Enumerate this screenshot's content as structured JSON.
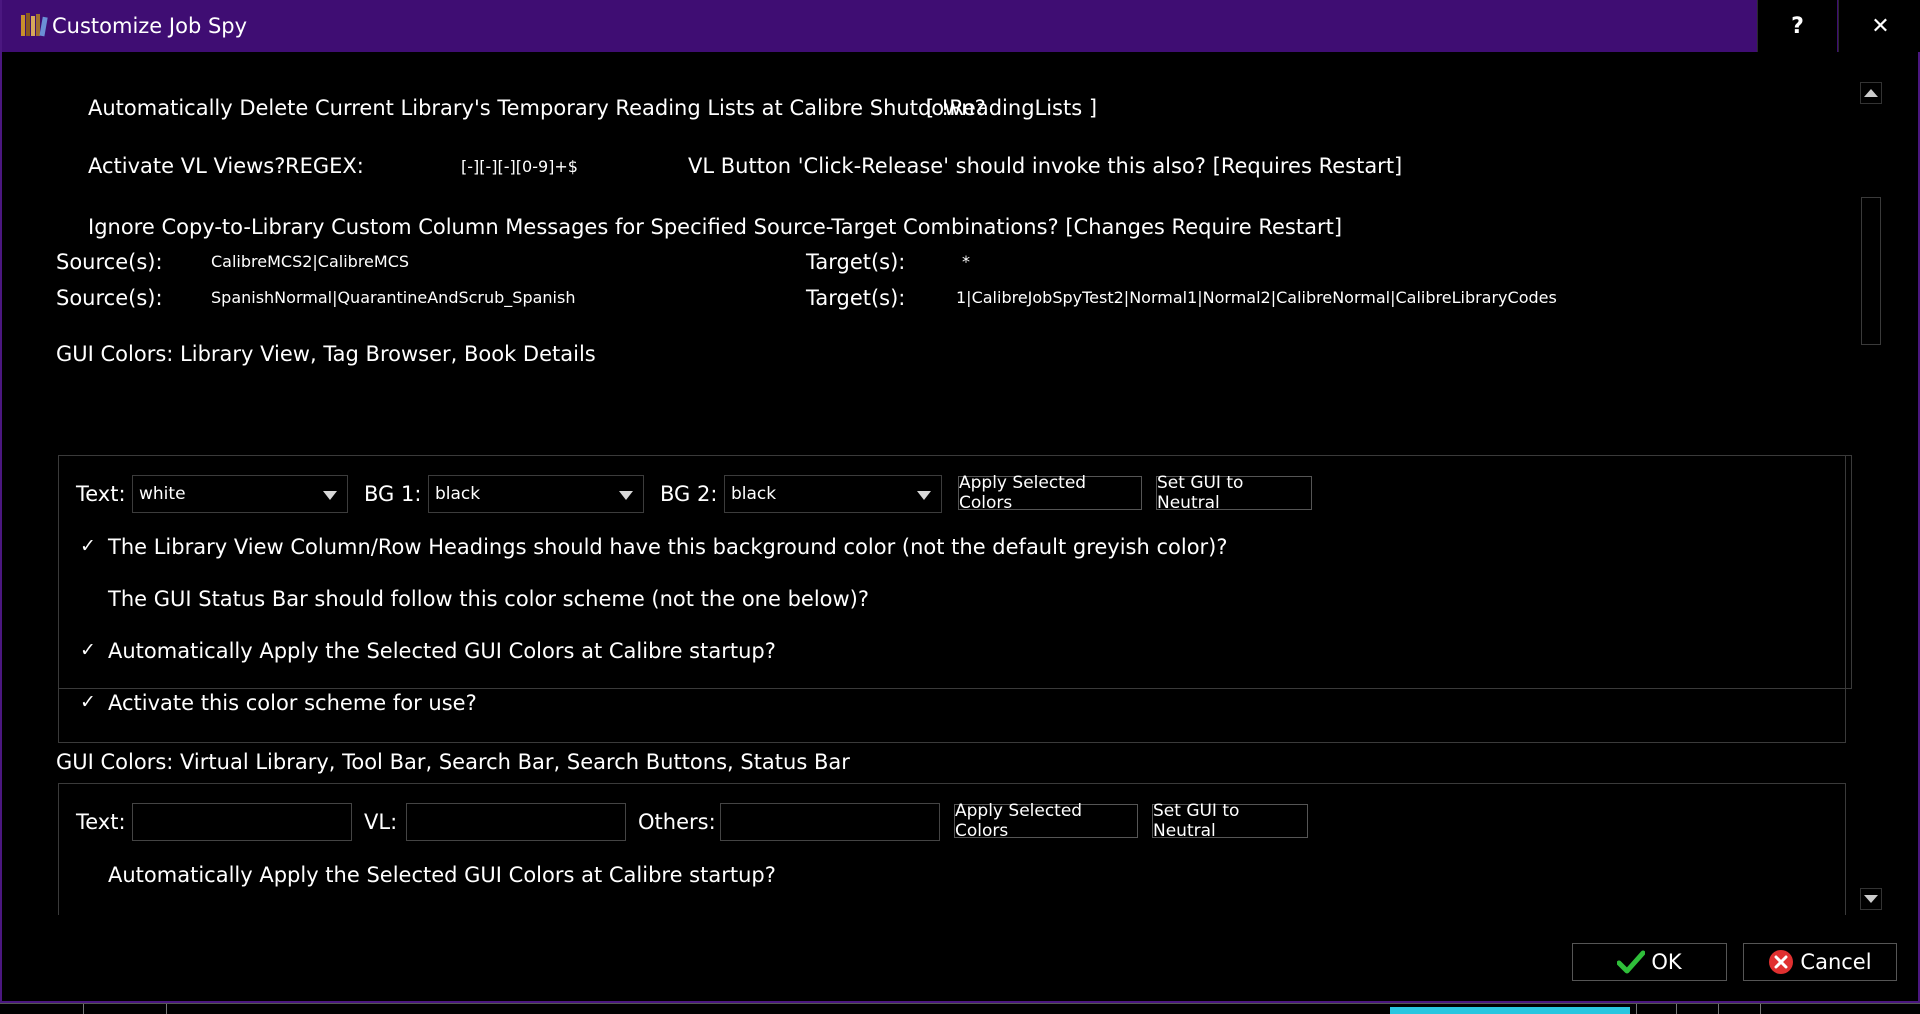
{
  "window": {
    "title": "Customize Job Spy",
    "help_label": "?",
    "close_label": "✕",
    "accent_color": "#3f0d73"
  },
  "content": {
    "delete_reading_lists_label": "Automatically Delete Current Library's Temporary Reading Lists at Calibre Shutdown?",
    "reading_lists_value": "[ !ReadingLists ]",
    "vl_views_label": "Activate VL Views?",
    "regex_label": "REGEX:",
    "regex_value": "[-][-][-][0-9]+$",
    "vl_button_label": "VL Button 'Click-Release' should invoke this also? [Requires Restart]",
    "ignore_copy_label": "Ignore Copy-to-Library Custom Column Messages for Specified Source-Target Combinations? [Changes Require Restart]",
    "source_target_rows": [
      {
        "source_label": "Source(s):",
        "source_value": "CalibreMCS2|CalibreMCS",
        "target_label": "Target(s):",
        "target_value": "*"
      },
      {
        "source_label": "Source(s):",
        "source_value": "SpanishNormal|QuarantineAndScrub_Spanish",
        "target_label": "Target(s):",
        "target_value": "1|CalibreJobSpyTest2|Normal1|Normal2|CalibreNormal|CalibreLibraryCodes"
      }
    ],
    "gui_colors_1": {
      "heading": "GUI Colors: Library View, Tag Browser, Book Details",
      "text_label": "Text:",
      "text_value": "white",
      "bg1_label": "BG 1:",
      "bg1_value": "black",
      "bg2_label": "BG 2:",
      "bg2_value": "black",
      "apply_label": "Apply Selected Colors",
      "neutral_label": "Set GUI to Neutral",
      "check_mark": "✓",
      "options": [
        {
          "label": "The Library View Column/Row Headings should have this background color (not the default greyish color)?",
          "checked": true
        },
        {
          "label": "The GUI Status Bar should follow this color scheme (not the one below)?",
          "checked": false
        },
        {
          "label": "Automatically Apply the Selected GUI Colors at Calibre startup?",
          "checked": true
        },
        {
          "label": "Activate this color scheme for use?",
          "checked": true
        }
      ]
    },
    "gui_colors_2": {
      "heading": "GUI Colors: Virtual Library, Tool Bar, Search Bar, Search Buttons, Status Bar",
      "text_label": "Text:",
      "vl_label": "VL:",
      "others_label": "Others:",
      "apply_label": "Apply Selected Colors",
      "neutral_label": "Set GUI to Neutral",
      "auto_apply_label": "Automatically Apply the Selected GUI Colors at Calibre startup?"
    }
  },
  "buttons": {
    "ok_label": "OK",
    "cancel_label": "Cancel"
  }
}
